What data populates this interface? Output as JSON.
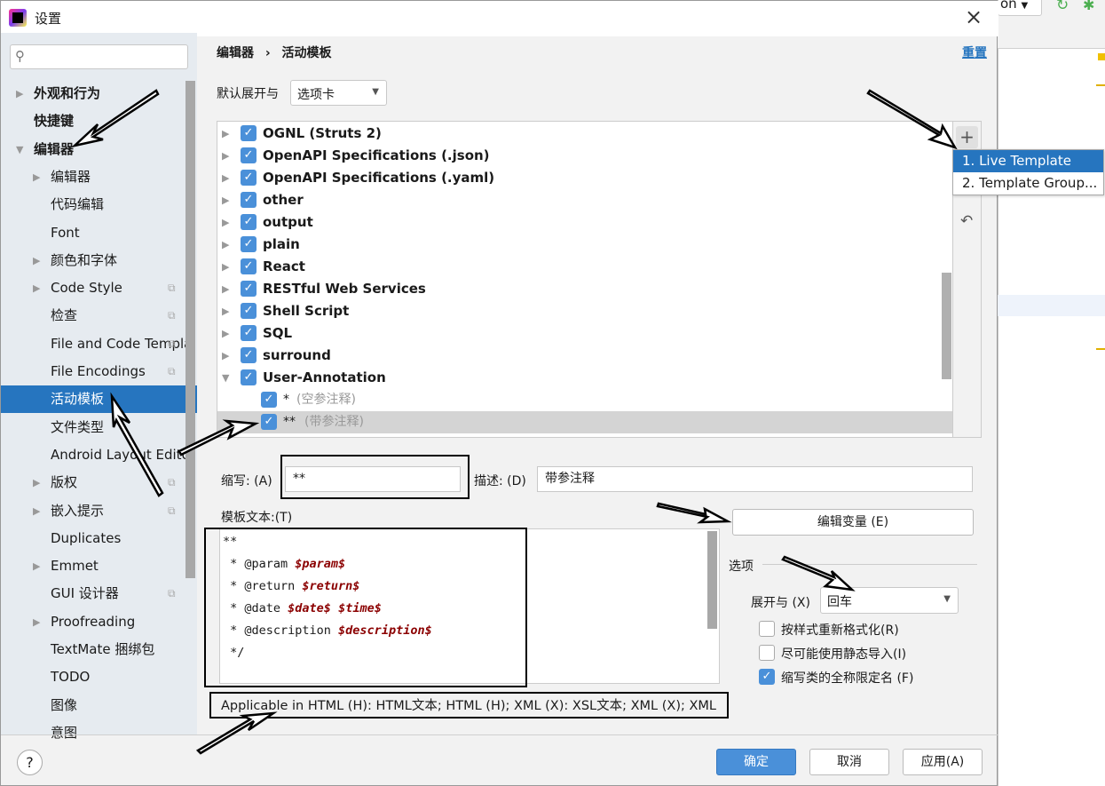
{
  "window": {
    "title": "设置",
    "close": "×"
  },
  "ide_bg": {
    "dropdown_text": "on"
  },
  "search": {
    "placeholder": ""
  },
  "sidebar": {
    "items": [
      {
        "label": "外观和行为",
        "level": 0,
        "arrow": "right",
        "bold": true
      },
      {
        "label": "快捷键",
        "level": 0,
        "bold": true
      },
      {
        "label": "编辑器",
        "level": 0,
        "arrow": "down",
        "bold": true
      },
      {
        "label": "编辑器",
        "level": 1,
        "arrow": "right"
      },
      {
        "label": "代码编辑",
        "level": 1
      },
      {
        "label": "Font",
        "level": 1
      },
      {
        "label": "颜色和字体",
        "level": 1,
        "arrow": "right"
      },
      {
        "label": "Code Style",
        "level": 1,
        "arrow": "right",
        "copy": true
      },
      {
        "label": "检查",
        "level": 1,
        "copy": true
      },
      {
        "label": "File and Code Templates",
        "level": 1,
        "copy": true
      },
      {
        "label": "File Encodings",
        "level": 1,
        "copy": true
      },
      {
        "label": "活动模板",
        "level": 1,
        "selected": true
      },
      {
        "label": "文件类型",
        "level": 1
      },
      {
        "label": "Android Layout Editor",
        "level": 1
      },
      {
        "label": "版权",
        "level": 1,
        "arrow": "right",
        "copy": true
      },
      {
        "label": "嵌入提示",
        "level": 1,
        "arrow": "right",
        "copy": true
      },
      {
        "label": "Duplicates",
        "level": 1
      },
      {
        "label": "Emmet",
        "level": 1,
        "arrow": "right"
      },
      {
        "label": "GUI 设计器",
        "level": 1,
        "copy": true
      },
      {
        "label": "Proofreading",
        "level": 1,
        "arrow": "right"
      },
      {
        "label": "TextMate 捆绑包",
        "level": 1
      },
      {
        "label": "TODO",
        "level": 1
      },
      {
        "label": "图像",
        "level": 1
      },
      {
        "label": "意图",
        "level": 1
      }
    ]
  },
  "breadcrumb": {
    "parent": "编辑器",
    "separator": "›",
    "current": "活动模板",
    "reset": "重置"
  },
  "expand_default": {
    "label": "默认展开与",
    "value": "选项卡"
  },
  "tree": [
    {
      "label": "OGNL (Struts 2)",
      "checked": true,
      "arrow": "right"
    },
    {
      "label": "OpenAPI Specifications (.json)",
      "checked": true,
      "arrow": "right"
    },
    {
      "label": "OpenAPI Specifications (.yaml)",
      "checked": true,
      "arrow": "right"
    },
    {
      "label": "other",
      "checked": true,
      "arrow": "right"
    },
    {
      "label": "output",
      "checked": true,
      "arrow": "right"
    },
    {
      "label": "plain",
      "checked": true,
      "arrow": "right"
    },
    {
      "label": "React",
      "checked": true,
      "arrow": "right"
    },
    {
      "label": "RESTful Web Services",
      "checked": true,
      "arrow": "right"
    },
    {
      "label": "Shell Script",
      "checked": true,
      "arrow": "right"
    },
    {
      "label": "SQL",
      "checked": true,
      "arrow": "right"
    },
    {
      "label": "surround",
      "checked": true,
      "arrow": "right"
    },
    {
      "label": "User-Annotation",
      "checked": true,
      "arrow": "down"
    },
    {
      "label": "*",
      "desc": "(空参注释)",
      "checked": true,
      "child": true
    },
    {
      "label": "**",
      "desc": "(带参注释)",
      "checked": true,
      "child": true,
      "selected": true
    }
  ],
  "toolbar": {
    "add": "+",
    "copy": "⧉",
    "revert": "↶"
  },
  "add_menu": {
    "items": [
      "1. Live Template",
      "2. Template Group..."
    ]
  },
  "abbrev": {
    "label": "缩写: (A)",
    "value": "**"
  },
  "description": {
    "label": "描述: (D)",
    "value": "带参注释"
  },
  "template_text": {
    "label": "模板文本:(T)",
    "lines": [
      [
        {
          "t": "**"
        }
      ],
      [
        {
          "t": " * @param "
        },
        {
          "v": "$param$"
        }
      ],
      [
        {
          "t": " * @return "
        },
        {
          "v": "$return$"
        }
      ],
      [
        {
          "t": " * @date "
        },
        {
          "v": "$date$"
        },
        {
          "t": " "
        },
        {
          "v": "$time$"
        }
      ],
      [
        {
          "t": " * @description "
        },
        {
          "v": "$description$"
        }
      ],
      [
        {
          "t": " */"
        }
      ]
    ]
  },
  "edit_vars": "编辑变量 (E)",
  "options": {
    "title": "选项",
    "expand_label": "展开与 (X)",
    "expand_value": "回车",
    "checkboxes": [
      {
        "label": "按样式重新格式化(R)",
        "checked": false
      },
      {
        "label": "尽可能使用静态导入(I)",
        "checked": false
      },
      {
        "label": "缩写类的全称限定名 (F)",
        "checked": true
      }
    ]
  },
  "applicable": "Applicable in HTML (H): HTML文本; HTML (H); XML (X): XSL文本; XML (X); XML",
  "footer": {
    "help": "?",
    "ok": "确定",
    "cancel": "取消",
    "apply": "应用(A)"
  },
  "colors": {
    "accent": "#2675bf",
    "checkbox": "#4a90d9",
    "variable": "#8b0000"
  }
}
